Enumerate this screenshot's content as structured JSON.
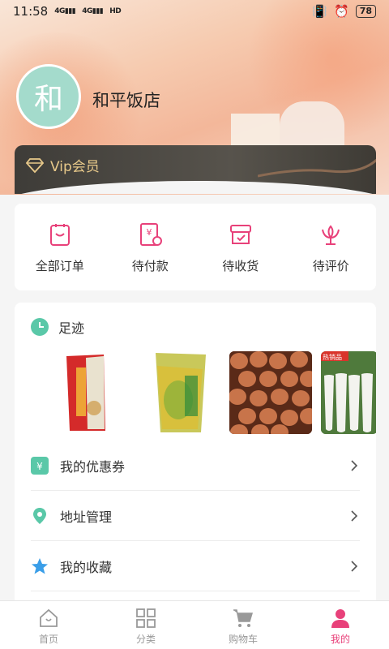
{
  "status": {
    "time": "11:58",
    "net1": "4G",
    "net2": "4G",
    "hd": "HD",
    "battery": "78"
  },
  "profile": {
    "avatar_char": "和",
    "shop_name": "和平饭店"
  },
  "vip": {
    "label": "Vip会员"
  },
  "orders": [
    {
      "label": "全部订单",
      "icon": "order-list-icon"
    },
    {
      "label": "待付款",
      "icon": "pending-payment-icon"
    },
    {
      "label": "待收货",
      "icon": "pending-delivery-icon"
    },
    {
      "label": "待评价",
      "icon": "pending-review-icon"
    }
  ],
  "footprint": {
    "title": "足迹",
    "items": [
      {
        "name": "rice-bag",
        "tag": ""
      },
      {
        "name": "pickled-vegetable-pack",
        "tag": ""
      },
      {
        "name": "brown-eggs",
        "tag": ""
      },
      {
        "name": "white-radish",
        "tag": "热销品"
      }
    ]
  },
  "menu": [
    {
      "label": "我的优惠券",
      "icon": "coupon-icon"
    },
    {
      "label": "地址管理",
      "icon": "location-pin-icon"
    },
    {
      "label": "我的收藏",
      "icon": "star-icon"
    }
  ],
  "tabs": [
    {
      "label": "首页",
      "icon": "home-icon"
    },
    {
      "label": "分类",
      "icon": "grid-icon"
    },
    {
      "label": "购物车",
      "icon": "cart-icon"
    },
    {
      "label": "我的",
      "icon": "user-icon"
    }
  ],
  "colors": {
    "accent": "#e8417a",
    "vip_gold": "#e8c98a",
    "avatar": "#a4dbcc",
    "menu_green": "#5ac8a8",
    "star_blue": "#3a9ee8"
  }
}
